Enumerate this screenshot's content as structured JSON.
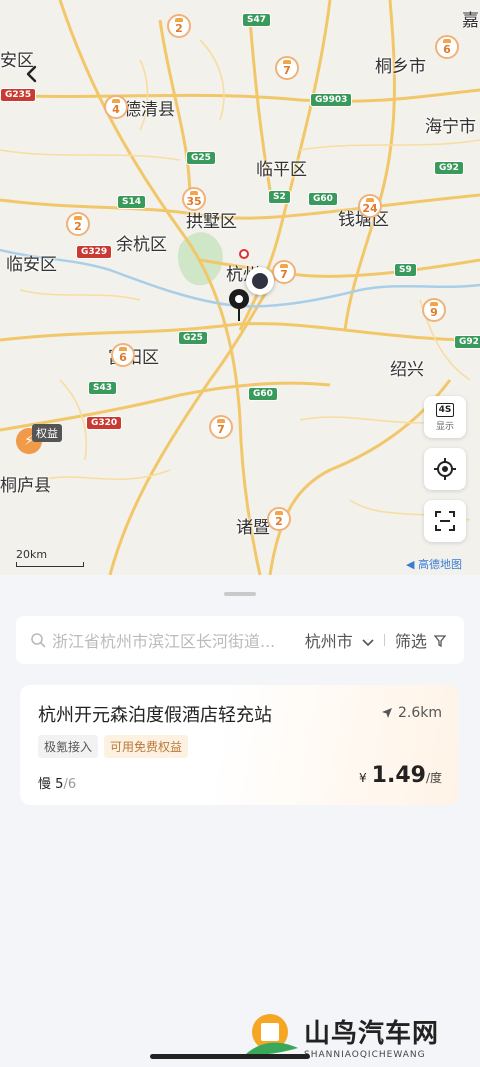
{
  "map": {
    "cities": {
      "jia": "嘉",
      "tongxiang": "桐乡市",
      "deqing": "德清县",
      "haining": "海宁市",
      "linping": "临平区",
      "gongshu": "拱墅区",
      "qiantang": "钱塘区",
      "yuhang": "余杭区",
      "linan": "临安区",
      "hangzhou": "杭州",
      "fuyang": "富阳区",
      "shaoxing": "绍兴",
      "tonglu": "桐庐县",
      "zhuji": "诸暨",
      "an": "安区"
    },
    "roads": {
      "s47": "S47",
      "g235": "G235",
      "g9903": "G9903",
      "g25a": "G25",
      "g92a": "G92",
      "s14": "S14",
      "s2": "S2",
      "g60a": "G60",
      "g329": "G329",
      "s9": "S9",
      "g25b": "G25",
      "g92b": "G92",
      "s43": "S43",
      "g60b": "G60",
      "g320": "G320"
    },
    "pins": {
      "p1": "2",
      "p2": "6",
      "p3": "7",
      "p4": "4",
      "p5": "35",
      "p6": "24",
      "p7": "2",
      "p8": "7",
      "p9": "9",
      "p10": "6",
      "p11": "7",
      "p12": "2"
    },
    "quanyi": "权益",
    "scale": "20km",
    "amap": "高德地图",
    "tools": {
      "display_label": "显示",
      "display_badge": "4S"
    }
  },
  "search": {
    "placeholder": "浙江省杭州市滨江区长河街道...",
    "city": "杭州市",
    "filter": "筛选"
  },
  "station": {
    "name": "杭州开元森泊度假酒店轻充站",
    "distance": "2.6km",
    "tags": [
      "极氪接入",
      "可用免费权益"
    ],
    "slow_label": "慢",
    "available": "5",
    "total": "/6",
    "currency": "¥",
    "price": "1.49",
    "unit": "/度"
  },
  "watermark": {
    "title": "山鸟汽车网",
    "subtitle": "SHANNIAOQICHEWANG"
  },
  "colors": {
    "accent": "#e07b2c",
    "highway": "#3a9a5c",
    "national_road": "#c93a33",
    "route_blue": "#3a7bd5"
  }
}
